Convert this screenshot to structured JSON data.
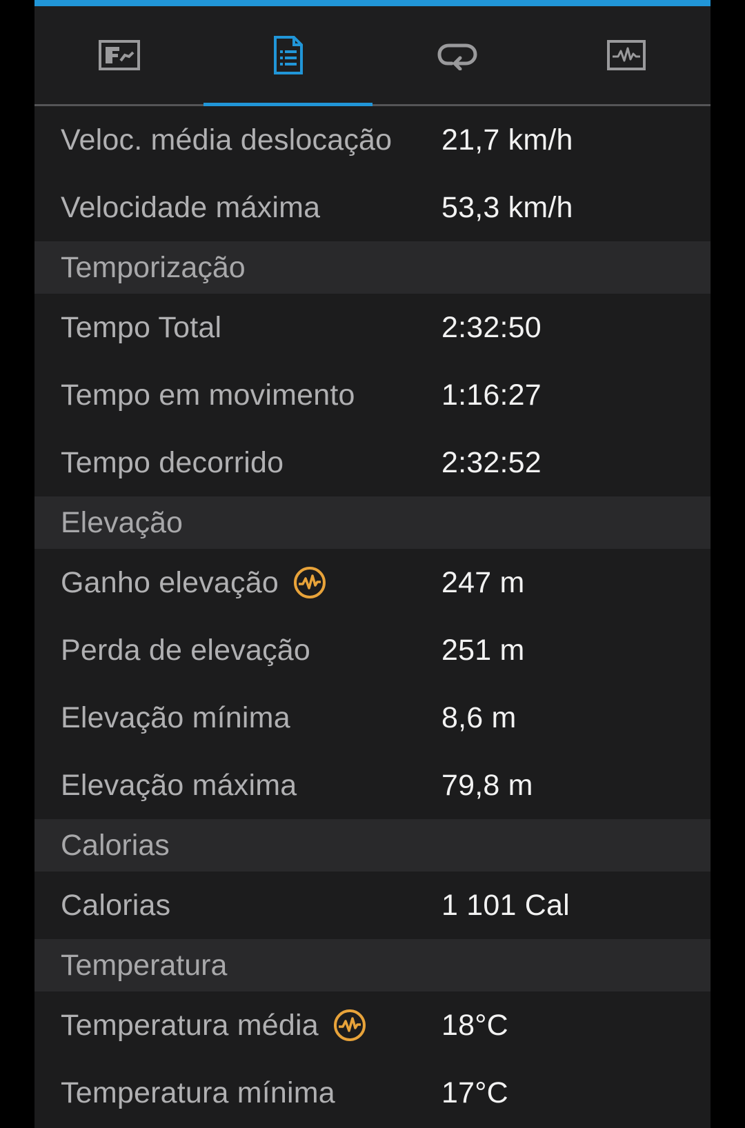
{
  "colors": {
    "accent": "#2196d8",
    "badge": "#e8a33a",
    "background": "#1c1c1d",
    "section": "#29292b"
  },
  "tabs": [
    {
      "icon": "summary-chart-icon",
      "active": false
    },
    {
      "icon": "document-list-icon",
      "active": true
    },
    {
      "icon": "loop-icon",
      "active": false
    },
    {
      "icon": "activity-graph-icon",
      "active": false
    }
  ],
  "speed": {
    "avg_moving_label": "Veloc. média deslocação",
    "avg_moving_value": "21,7 km/h",
    "max_label": "Velocidade máxima",
    "max_value": "53,3 km/h"
  },
  "timing": {
    "header": "Temporização",
    "total_label": "Tempo Total",
    "total_value": "2:32:50",
    "moving_label": "Tempo em movimento",
    "moving_value": "1:16:27",
    "elapsed_label": "Tempo decorrido",
    "elapsed_value": "2:32:52"
  },
  "elevation": {
    "header": "Elevação",
    "gain_label": "Ganho elevação",
    "gain_value": "247 m",
    "loss_label": "Perda de elevação",
    "loss_value": "251 m",
    "min_label": "Elevação mínima",
    "min_value": "8,6 m",
    "max_label": "Elevação máxima",
    "max_value": "79,8 m"
  },
  "calories": {
    "header": "Calorias",
    "label": "Calorias",
    "value": "1 101 Cal"
  },
  "temperature": {
    "header": "Temperatura",
    "avg_label": "Temperatura média",
    "avg_value": "18°C",
    "min_label": "Temperatura mínima",
    "min_value": "17°C"
  }
}
